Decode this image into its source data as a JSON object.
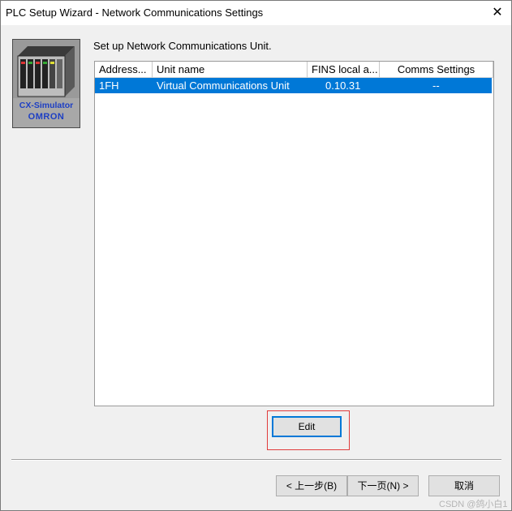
{
  "window": {
    "title": "PLC Setup Wizard - Network Communications Settings",
    "close_glyph": "✕"
  },
  "logo": {
    "line1": "CX-Simulator",
    "line2": "OMRON"
  },
  "prompt": "Set up Network Communications Unit.",
  "list": {
    "columns": [
      "Address...",
      "Unit name",
      "FINS local a...",
      "Comms Settings"
    ],
    "rows": [
      {
        "address": "1FH",
        "unit_name": "Virtual Communications Unit",
        "fins_local": "0.10.31",
        "comms": "--"
      }
    ],
    "selected_row_color": "#0078d7"
  },
  "buttons": {
    "edit": "Edit",
    "back": "< 上一步(B)",
    "next": "下一页(N) >",
    "cancel": "取消"
  },
  "highlight_color": "#e03c3c",
  "watermark": "CSDN @鸽小白1"
}
